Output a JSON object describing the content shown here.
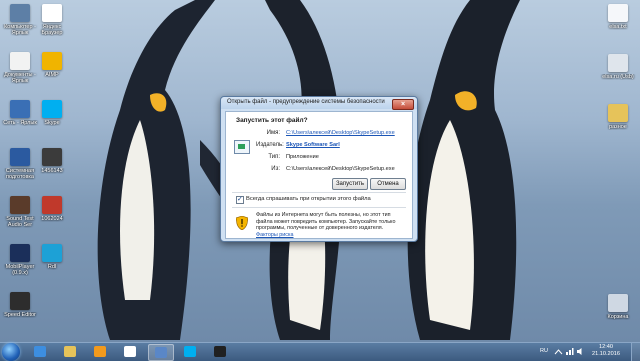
{
  "desktop": {
    "left_icons": [
      {
        "label": "Компьютер - Ярлык",
        "name": "computer-shortcut",
        "icon": "computer-icon",
        "color": "#5d7fa6"
      },
      {
        "label": "Документы - Ярлык",
        "name": "documents-shortcut",
        "icon": "documents-icon",
        "color": "#f2f2f2"
      },
      {
        "label": "Сеть - Ярлык",
        "name": "network-shortcut",
        "icon": "network-icon",
        "color": "#3a6fb5"
      },
      {
        "label": "Системная подготовка",
        "name": "system-shortcut",
        "icon": "system-icon",
        "color": "#2b5aa0"
      },
      {
        "label": "Sound Test Audio Ser",
        "name": "sound-test-shortcut",
        "icon": "app-icon",
        "color": "#5a3b2a"
      },
      {
        "label": "MobilPlayer (0.9.x)",
        "name": "mobilplayer-shortcut",
        "icon": "app-icon",
        "color": "#1b2f5a"
      },
      {
        "label": "Speed Editor",
        "name": "speed-editor-shortcut",
        "icon": "app-icon",
        "color": "#2d2d2d"
      }
    ],
    "second_icons": [
      {
        "label": "Яндекс Браузер",
        "name": "yandex-browser-shortcut",
        "icon": "yandex-icon",
        "color": "#ffffff"
      },
      {
        "label": "AIMP",
        "name": "aimp-shortcut",
        "icon": "aimp-icon",
        "color": "#f0b400"
      },
      {
        "label": "Skype",
        "name": "skype-shortcut",
        "icon": "skype-icon",
        "color": "#00aff0"
      },
      {
        "label": "1456143",
        "name": "folder-1456143",
        "icon": "folder-icon",
        "color": "#3b3b3b"
      },
      {
        "label": "1062024",
        "name": "folder-1062024",
        "icon": "folder-icon",
        "color": "#c0392b"
      },
      {
        "label": "Rdl",
        "name": "rdl-shortcut",
        "icon": "app-icon",
        "color": "#1da1d6"
      }
    ],
    "right_icons": [
      {
        "label": "elsa.txt",
        "name": "elsa-file",
        "icon": "text-file-icon",
        "color": "#f5f7fa"
      },
      {
        "label": "elsa.ru (Usb)",
        "name": "elsa-usb-shortcut",
        "icon": "drive-icon",
        "color": "#dfe5ec"
      },
      {
        "label": "разное",
        "name": "folder-misc",
        "icon": "folder-icon",
        "color": "#e6c35a"
      },
      {
        "label": "Корзина",
        "name": "recycle-bin",
        "icon": "recycle-bin-icon",
        "color": "#cfd8e3"
      }
    ]
  },
  "dialog": {
    "title": "Открыть файл - предупреждение системы безопасности",
    "question": "Запустить этот файл?",
    "name_label": "Имя:",
    "name_value": "C:\\Users\\алексей\\Desktop\\SkypeSetup.exe",
    "publisher_label": "Издатель:",
    "publisher_value": "Skype Software Sarl",
    "type_label": "Тип:",
    "type_value": "Приложение",
    "from_label": "Из:",
    "from_value": "C:\\Users\\алексей\\Desktop\\SkypeSetup.exe",
    "run_button": "Запустить",
    "cancel_button": "Отмена",
    "always_ask": "Всегда спрашивать при открытии этого файла",
    "always_ask_checked": true,
    "warning_text": "Файлы из Интернета могут быть полезны, но этот тип файла может повредить компьютер. Запускайте только программы, полученные от доверенного издателя.",
    "warning_link": "Факторы риска",
    "close": "×"
  },
  "taskbar": {
    "items": [
      {
        "name": "ie-button",
        "icon": "internet-explorer-icon",
        "color": "#3d8ee0",
        "active": false
      },
      {
        "name": "explorer-button",
        "icon": "folder-icon",
        "color": "#e6c35a",
        "active": false
      },
      {
        "name": "media-player-button",
        "icon": "media-player-icon",
        "color": "#f29a1d",
        "active": false
      },
      {
        "name": "yandex-button",
        "icon": "yandex-icon",
        "color": "#ffffff",
        "active": false
      },
      {
        "name": "network-task-button",
        "icon": "network-icon",
        "color": "#5a87c7",
        "active": true
      },
      {
        "name": "skype-task-button",
        "icon": "skype-icon",
        "color": "#00aff0",
        "active": false
      },
      {
        "name": "obs-button",
        "icon": "obs-icon",
        "color": "#202020",
        "active": false
      }
    ],
    "lang": "RU",
    "time": "12:40",
    "date": "21.10.2016"
  }
}
